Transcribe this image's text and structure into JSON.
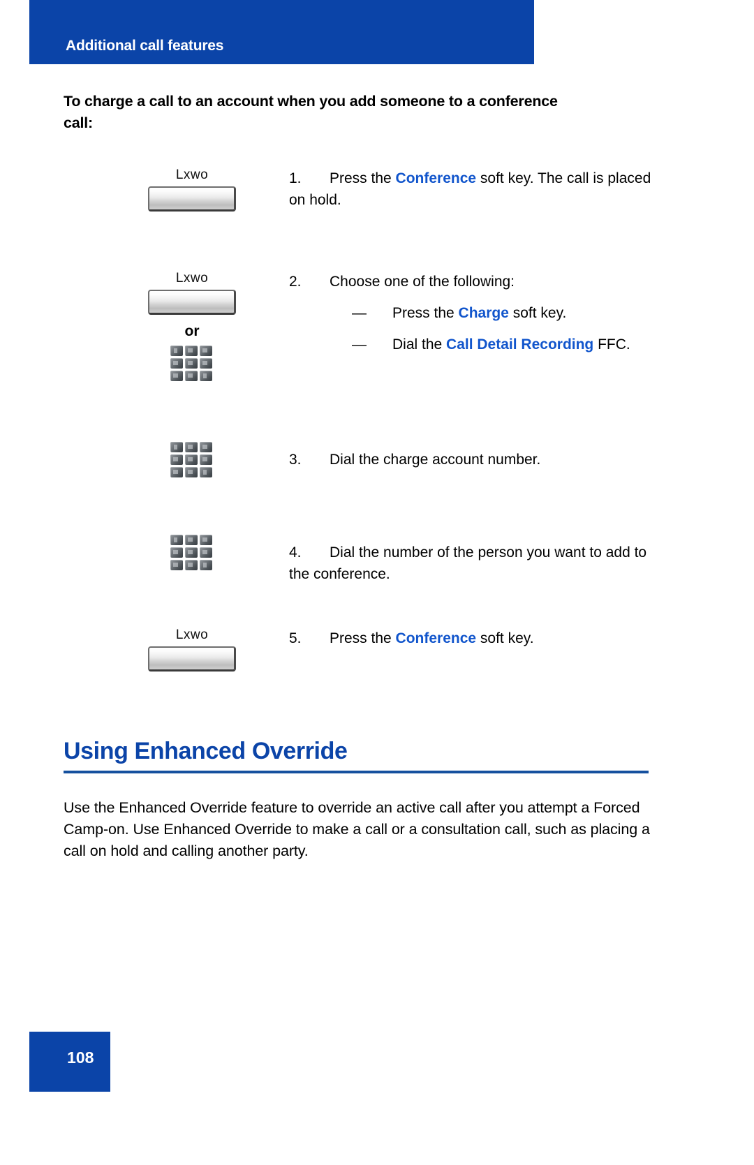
{
  "header": {
    "banner_title": "Additional call features",
    "banner_color": "#0B44A8"
  },
  "task": {
    "heading": "To charge a call to an account when you add someone to a conference call:"
  },
  "icons": {
    "softkey_label": "Lxwo",
    "or_label": "or"
  },
  "steps": [
    {
      "number": "1.",
      "text_before": "Press the ",
      "keyword": "Conference",
      "text_after": " soft key. The call is placed on hold.",
      "icon": "softkey"
    },
    {
      "number": "2.",
      "text_before": "Choose one of the following:",
      "keyword": "",
      "text_after": "",
      "icon": "softkey-or-keypad",
      "sub_items": [
        {
          "dash": "—",
          "text_before": "Press the ",
          "keyword": "Charge",
          "text_after": " soft key."
        },
        {
          "dash": "—",
          "text_before": "Dial the ",
          "keyword": "Call Detail Recording",
          "text_after": " FFC."
        }
      ]
    },
    {
      "number": "3.",
      "text_before": "Dial the charge account number.",
      "keyword": "",
      "text_after": "",
      "icon": "keypad"
    },
    {
      "number": "4.",
      "text_before": "Dial the number of the person you want to add to the conference.",
      "keyword": "",
      "text_after": "",
      "icon": "keypad"
    },
    {
      "number": "5.",
      "text_before": "Press the ",
      "keyword": "Conference",
      "text_after": " soft key.",
      "icon": "softkey"
    }
  ],
  "section": {
    "heading": "Using Enhanced Override",
    "heading_color": "#0B44A8",
    "paragraph": "Use the Enhanced Override feature to override an active call after you attempt a Forced Camp-on. Use Enhanced Override to make a call or a consultation call, such as placing a call on hold and calling another party."
  },
  "footer": {
    "page_number": "108"
  }
}
